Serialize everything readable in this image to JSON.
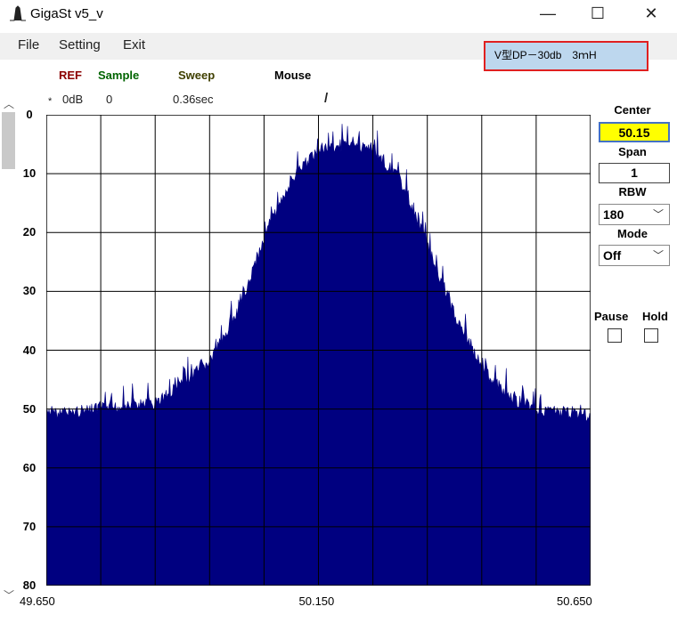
{
  "window": {
    "title": "GigaSt v5_v",
    "minimize_glyph": "—",
    "maximize_glyph": "☐",
    "close_glyph": "✕"
  },
  "menu": {
    "file": "File",
    "setting": "Setting",
    "exit": "Exit"
  },
  "note": "V型DP－30db　3ｍH",
  "header": {
    "ref_label": "REF",
    "sample_label": "Sample",
    "sweep_label": "Sweep",
    "mouse_label": "Mouse",
    "ref_marker": "*",
    "ref_value": "0dB",
    "sample_value": "0",
    "sweep_value": "0.36sec",
    "mouse_value": "/"
  },
  "controls": {
    "center_label": "Center",
    "center_value": "50.15",
    "span_label": "Span",
    "span_value": "1",
    "rbw_label": "RBW",
    "rbw_value": "180",
    "mode_label": "Mode",
    "mode_value": "Off",
    "pause_label": "Pause",
    "hold_label": "Hold"
  },
  "colors": {
    "trace": "#000080",
    "grid": "#000000",
    "note_bg": "#bdd7ee",
    "note_border": "#e02020",
    "center_bg": "#ffff00"
  },
  "chart_data": {
    "type": "area",
    "x_ticks": [
      "49.650",
      "50.150",
      "50.650"
    ],
    "y_ticks": [
      "0",
      "10",
      "20",
      "30",
      "40",
      "50",
      "60",
      "70",
      "80"
    ],
    "xlim": [
      49.65,
      50.65
    ],
    "ylim": [
      0,
      80
    ],
    "y_inverted": true,
    "grid": true,
    "x": [
      49.65,
      49.75,
      49.85,
      49.95,
      50.0,
      50.05,
      50.1,
      50.15,
      50.2,
      50.25,
      50.3,
      50.35,
      50.4,
      50.45,
      50.5,
      50.55,
      50.65
    ],
    "y": [
      51,
      50,
      49,
      42,
      34,
      21,
      11,
      6,
      5,
      6,
      11,
      22,
      34,
      43,
      48,
      50,
      51
    ]
  }
}
